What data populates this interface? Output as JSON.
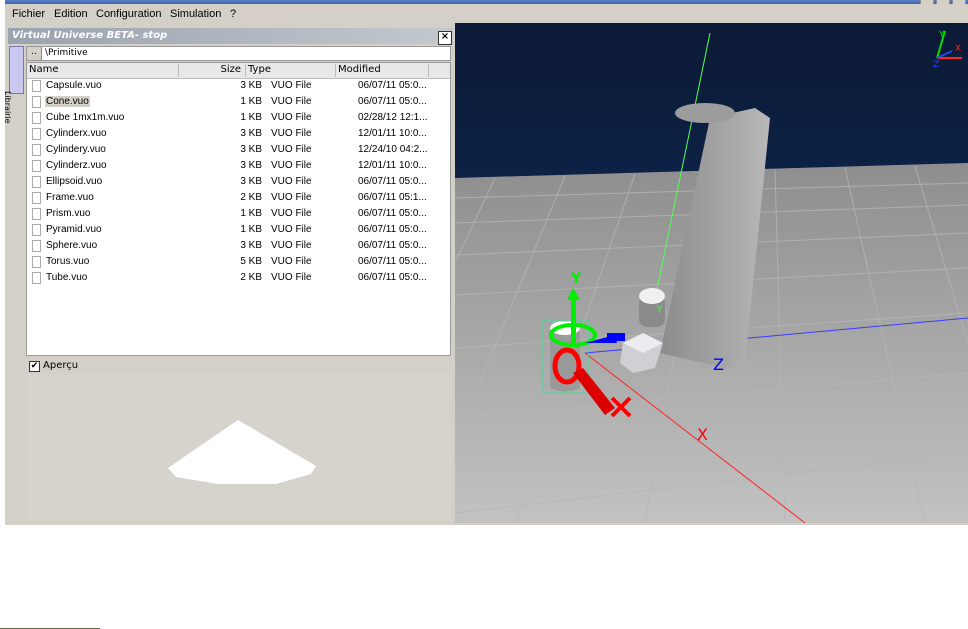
{
  "menu": [
    "Fichier",
    "Edition",
    "Configuration",
    "Simulation",
    "?"
  ],
  "panel": {
    "title": "Virtual Universe BETA- stop",
    "close_glyph": "×",
    "side_tab": "Librairie",
    "up_button": "..",
    "path": "\\Primitive"
  },
  "file_list": {
    "columns": [
      "Name",
      "Size",
      "Type",
      "Modified"
    ],
    "rows": [
      {
        "name": "Capsule.vuo",
        "size": "3 KB",
        "type": "VUO File",
        "modified": "06/07/11 05:0..."
      },
      {
        "name": "Cone.vuo",
        "size": "1 KB",
        "type": "VUO File",
        "modified": "06/07/11 05:0...",
        "selected": true
      },
      {
        "name": "Cube 1mx1m.vuo",
        "size": "1 KB",
        "type": "VUO File",
        "modified": "02/28/12 12:1..."
      },
      {
        "name": "Cylinderx.vuo",
        "size": "3 KB",
        "type": "VUO File",
        "modified": "12/01/11 10:0..."
      },
      {
        "name": "Cylindery.vuo",
        "size": "3 KB",
        "type": "VUO File",
        "modified": "12/24/10 04:2..."
      },
      {
        "name": "Cylinderz.vuo",
        "size": "3 KB",
        "type": "VUO File",
        "modified": "12/01/11 10:0..."
      },
      {
        "name": "Ellipsoid.vuo",
        "size": "3 KB",
        "type": "VUO File",
        "modified": "06/07/11 05:0..."
      },
      {
        "name": "Frame.vuo",
        "size": "2 KB",
        "type": "VUO File",
        "modified": "06/07/11 05:1..."
      },
      {
        "name": "Prism.vuo",
        "size": "1 KB",
        "type": "VUO File",
        "modified": "06/07/11 05:0..."
      },
      {
        "name": "Pyramid.vuo",
        "size": "1 KB",
        "type": "VUO File",
        "modified": "06/07/11 05:0..."
      },
      {
        "name": "Sphere.vuo",
        "size": "3 KB",
        "type": "VUO File",
        "modified": "06/07/11 05:0..."
      },
      {
        "name": "Torus.vuo",
        "size": "5 KB",
        "type": "VUO File",
        "modified": "06/07/11 05:0..."
      },
      {
        "name": "Tube.vuo",
        "size": "2 KB",
        "type": "VUO File",
        "modified": "06/07/11 05:0..."
      }
    ]
  },
  "preview": {
    "checkbox_label": "Aperçu",
    "checked": true,
    "check_glyph": "✔"
  },
  "viewport": {
    "axis_labels": {
      "x": "X",
      "y": "Y",
      "z": "Z"
    },
    "colors": {
      "sky": "#0c1e3c",
      "floor": "#a9a9a9",
      "x_axis": "#ff0000",
      "y_axis": "#00cc00",
      "z_axis": "#0000ff"
    }
  }
}
